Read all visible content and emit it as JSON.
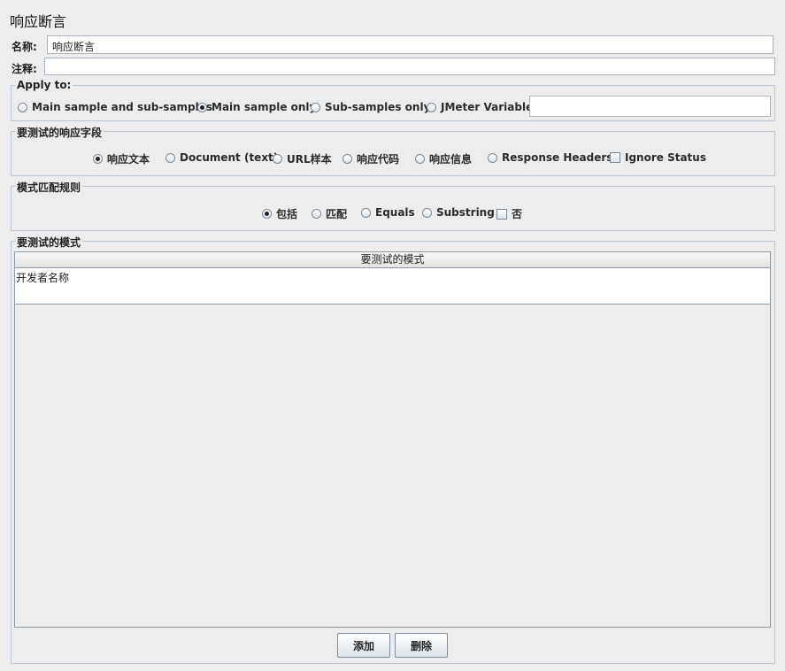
{
  "title": "响应断言",
  "name": {
    "label": "名称:",
    "value": "响应断言"
  },
  "comment": {
    "label": "注释:",
    "value": ""
  },
  "apply_to": {
    "title": "Apply to:",
    "options": [
      "Main sample and sub-samples",
      "Main sample only",
      "Sub-samples only",
      "JMeter Variable"
    ],
    "selected": "Main sample only",
    "variable_value": ""
  },
  "response_field": {
    "title": "要测试的响应字段",
    "options": [
      "响应文本",
      "Document (text)",
      "URL样本",
      "响应代码",
      "响应信息",
      "Response Headers"
    ],
    "selected": "响应文本",
    "ignore_status_label": "Ignore Status",
    "ignore_status_checked": false
  },
  "match_rules": {
    "title": "模式匹配规则",
    "options": [
      "包括",
      "匹配",
      "Equals",
      "Substring"
    ],
    "selected": "包括",
    "not_label": "否",
    "not_checked": false
  },
  "patterns": {
    "title": "要测试的模式",
    "column_header": "要测试的模式",
    "rows": [
      "开发者名称"
    ]
  },
  "buttons": {
    "add": "添加",
    "delete": "删除"
  }
}
